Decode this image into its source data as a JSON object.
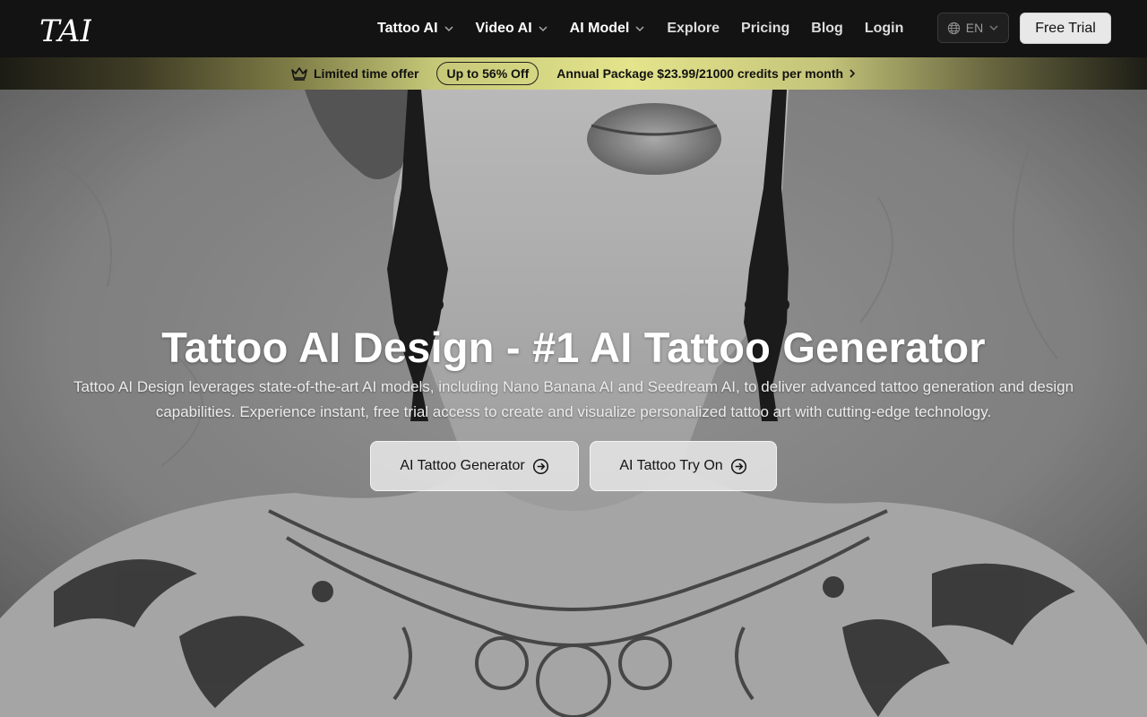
{
  "header": {
    "logo_text": "TAI",
    "nav": [
      {
        "label": "Tattoo AI",
        "dropdown": true
      },
      {
        "label": "Video AI",
        "dropdown": true
      },
      {
        "label": "AI Model",
        "dropdown": true
      },
      {
        "label": "Explore",
        "dropdown": false
      },
      {
        "label": "Pricing",
        "dropdown": false
      },
      {
        "label": "Blog",
        "dropdown": false
      },
      {
        "label": "Login",
        "dropdown": false
      }
    ],
    "language": "EN",
    "free_trial": "Free Trial"
  },
  "promo": {
    "limited": "Limited time offer",
    "badge": "Up to 56% Off",
    "annual": "Annual Package $23.99/21000 credits per month"
  },
  "hero": {
    "title": "Tattoo AI Design - #1 AI Tattoo Generator",
    "description": "Tattoo AI Design leverages state-of-the-art AI models, including Nano Banana AI and Seedream AI, to deliver advanced tattoo generation and design capabilities. Experience instant, free trial access to create and visualize personalized tattoo art with cutting-edge technology.",
    "buttons": [
      {
        "label": "AI Tattoo Generator"
      },
      {
        "label": "AI Tattoo Try On"
      }
    ]
  },
  "icons": [
    "globe-icon",
    "chevron-down-icon",
    "crown-icon",
    "chevron-right-icon",
    "arrow-right-circle-icon"
  ],
  "colors": {
    "header_bg": "#131313",
    "promo_gold": "#e4e48c",
    "button_bg": "#e1e1e1"
  }
}
